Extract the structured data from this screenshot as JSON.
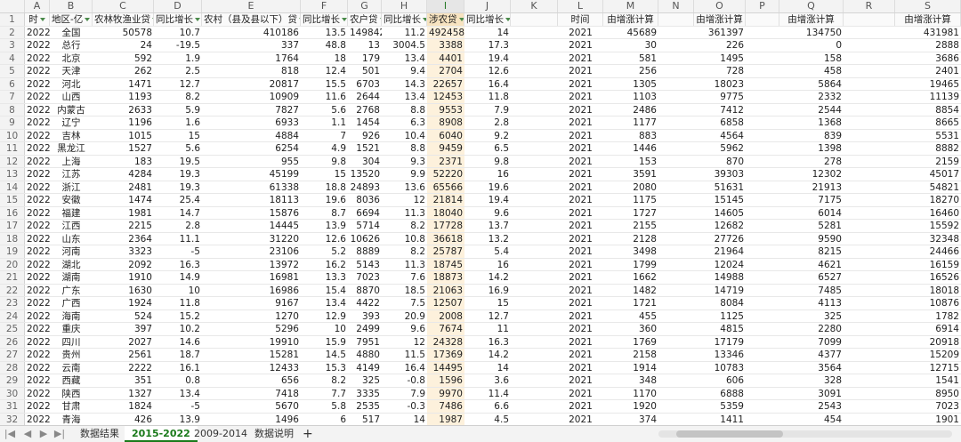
{
  "columns": [
    "A",
    "B",
    "C",
    "D",
    "E",
    "F",
    "G",
    "H",
    "I",
    "J",
    "K",
    "L",
    "M",
    "N",
    "O",
    "P",
    "Q",
    "R",
    "S"
  ],
  "selected_column": "I",
  "header": {
    "A": "时",
    "B": "地区-亿",
    "C": "农林牧渔业贷",
    "D": "同比增长",
    "E": "农村（县及县以下）贷",
    "F": "同比增长",
    "G": "农户贷",
    "H": "同比增长",
    "I": "涉农贷",
    "J": "同比增长",
    "L": "时间",
    "M": "由增涨计算",
    "O": "由增涨计算",
    "Q": "由增涨计算",
    "S": "由增涨计算"
  },
  "rows": [
    [
      "2",
      "2022",
      "全国",
      "50578",
      "10.7",
      "410186",
      "13.5",
      "149842",
      "11.2",
      "492458",
      "14",
      "",
      "2021",
      "45689",
      "",
      "361397",
      "",
      "134750",
      "",
      "431981"
    ],
    [
      "3",
      "2022",
      "总行",
      "24",
      "-19.5",
      "337",
      "48.8",
      "13",
      "3004.5",
      "3388",
      "17.3",
      "",
      "2021",
      "30",
      "",
      "226",
      "",
      "0",
      "",
      "2888"
    ],
    [
      "4",
      "2022",
      "北京",
      "592",
      "1.9",
      "1764",
      "18",
      "179",
      "13.4",
      "4401",
      "19.4",
      "",
      "2021",
      "581",
      "",
      "1495",
      "",
      "158",
      "",
      "3686"
    ],
    [
      "5",
      "2022",
      "天津",
      "262",
      "2.5",
      "818",
      "12.4",
      "501",
      "9.4",
      "2704",
      "12.6",
      "",
      "2021",
      "256",
      "",
      "728",
      "",
      "458",
      "",
      "2401"
    ],
    [
      "6",
      "2022",
      "河北",
      "1471",
      "12.7",
      "20817",
      "15.5",
      "6703",
      "14.3",
      "22657",
      "16.4",
      "",
      "2021",
      "1305",
      "",
      "18023",
      "",
      "5864",
      "",
      "19465"
    ],
    [
      "7",
      "2022",
      "山西",
      "1193",
      "8.2",
      "10909",
      "11.6",
      "2644",
      "13.4",
      "12453",
      "11.8",
      "",
      "2021",
      "1103",
      "",
      "9775",
      "",
      "2332",
      "",
      "11139"
    ],
    [
      "8",
      "2022",
      "内蒙古",
      "2633",
      "5.9",
      "7827",
      "5.6",
      "2768",
      "8.8",
      "9553",
      "7.9",
      "",
      "2021",
      "2486",
      "",
      "7412",
      "",
      "2544",
      "",
      "8854"
    ],
    [
      "9",
      "2022",
      "辽宁",
      "1196",
      "1.6",
      "6933",
      "1.1",
      "1454",
      "6.3",
      "8908",
      "2.8",
      "",
      "2021",
      "1177",
      "",
      "6858",
      "",
      "1368",
      "",
      "8665"
    ],
    [
      "10",
      "2022",
      "吉林",
      "1015",
      "15",
      "4884",
      "7",
      "926",
      "10.4",
      "6040",
      "9.2",
      "",
      "2021",
      "883",
      "",
      "4564",
      "",
      "839",
      "",
      "5531"
    ],
    [
      "11",
      "2022",
      "黑龙江",
      "1527",
      "5.6",
      "6254",
      "4.9",
      "1521",
      "8.8",
      "9459",
      "6.5",
      "",
      "2021",
      "1446",
      "",
      "5962",
      "",
      "1398",
      "",
      "8882"
    ],
    [
      "12",
      "2022",
      "上海",
      "183",
      "19.5",
      "955",
      "9.8",
      "304",
      "9.3",
      "2371",
      "9.8",
      "",
      "2021",
      "153",
      "",
      "870",
      "",
      "278",
      "",
      "2159"
    ],
    [
      "13",
      "2022",
      "江苏",
      "4284",
      "19.3",
      "45199",
      "15",
      "13520",
      "9.9",
      "52220",
      "16",
      "",
      "2021",
      "3591",
      "",
      "39303",
      "",
      "12302",
      "",
      "45017"
    ],
    [
      "14",
      "2022",
      "浙江",
      "2481",
      "19.3",
      "61338",
      "18.8",
      "24893",
      "13.6",
      "65566",
      "19.6",
      "",
      "2021",
      "2080",
      "",
      "51631",
      "",
      "21913",
      "",
      "54821"
    ],
    [
      "15",
      "2022",
      "安徽",
      "1474",
      "25.4",
      "18113",
      "19.6",
      "8036",
      "12",
      "21814",
      "19.4",
      "",
      "2021",
      "1175",
      "",
      "15145",
      "",
      "7175",
      "",
      "18270"
    ],
    [
      "16",
      "2022",
      "福建",
      "1981",
      "14.7",
      "15876",
      "8.7",
      "6694",
      "11.3",
      "18040",
      "9.6",
      "",
      "2021",
      "1727",
      "",
      "14605",
      "",
      "6014",
      "",
      "16460"
    ],
    [
      "17",
      "2022",
      "江西",
      "2215",
      "2.8",
      "14445",
      "13.9",
      "5714",
      "8.2",
      "17728",
      "13.7",
      "",
      "2021",
      "2155",
      "",
      "12682",
      "",
      "5281",
      "",
      "15592"
    ],
    [
      "18",
      "2022",
      "山东",
      "2364",
      "11.1",
      "31220",
      "12.6",
      "10626",
      "10.8",
      "36618",
      "13.2",
      "",
      "2021",
      "2128",
      "",
      "27726",
      "",
      "9590",
      "",
      "32348"
    ],
    [
      "19",
      "2022",
      "河南",
      "3323",
      "-5",
      "23106",
      "5.2",
      "8889",
      "8.2",
      "25787",
      "5.4",
      "",
      "2021",
      "3498",
      "",
      "21964",
      "",
      "8215",
      "",
      "24466"
    ],
    [
      "20",
      "2022",
      "湖北",
      "2092",
      "16.3",
      "13972",
      "16.2",
      "5143",
      "11.3",
      "18745",
      "16",
      "",
      "2021",
      "1799",
      "",
      "12024",
      "",
      "4621",
      "",
      "16159"
    ],
    [
      "21",
      "2022",
      "湖南",
      "1910",
      "14.9",
      "16981",
      "13.3",
      "7023",
      "7.6",
      "18873",
      "14.2",
      "",
      "2021",
      "1662",
      "",
      "14988",
      "",
      "6527",
      "",
      "16526"
    ],
    [
      "22",
      "2022",
      "广东",
      "1630",
      "10",
      "16986",
      "15.4",
      "8870",
      "18.5",
      "21063",
      "16.9",
      "",
      "2021",
      "1482",
      "",
      "14719",
      "",
      "7485",
      "",
      "18018"
    ],
    [
      "23",
      "2022",
      "广西",
      "1924",
      "11.8",
      "9167",
      "13.4",
      "4422",
      "7.5",
      "12507",
      "15",
      "",
      "2021",
      "1721",
      "",
      "8084",
      "",
      "4113",
      "",
      "10876"
    ],
    [
      "24",
      "2022",
      "海南",
      "524",
      "15.2",
      "1270",
      "12.9",
      "393",
      "20.9",
      "2008",
      "12.7",
      "",
      "2021",
      "455",
      "",
      "1125",
      "",
      "325",
      "",
      "1782"
    ],
    [
      "25",
      "2022",
      "重庆",
      "397",
      "10.2",
      "5296",
      "10",
      "2499",
      "9.6",
      "7674",
      "11",
      "",
      "2021",
      "360",
      "",
      "4815",
      "",
      "2280",
      "",
      "6914"
    ],
    [
      "26",
      "2022",
      "四川",
      "2027",
      "14.6",
      "19910",
      "15.9",
      "7951",
      "12",
      "24328",
      "16.3",
      "",
      "2021",
      "1769",
      "",
      "17179",
      "",
      "7099",
      "",
      "20918"
    ],
    [
      "27",
      "2022",
      "贵州",
      "2561",
      "18.7",
      "15281",
      "14.5",
      "4880",
      "11.5",
      "17369",
      "14.2",
      "",
      "2021",
      "2158",
      "",
      "13346",
      "",
      "4377",
      "",
      "15209"
    ],
    [
      "28",
      "2022",
      "云南",
      "2222",
      "16.1",
      "12433",
      "15.3",
      "4149",
      "16.4",
      "14495",
      "14",
      "",
      "2021",
      "1914",
      "",
      "10783",
      "",
      "3564",
      "",
      "12715"
    ],
    [
      "29",
      "2022",
      "西藏",
      "351",
      "0.8",
      "656",
      "8.2",
      "325",
      "-0.8",
      "1596",
      "3.6",
      "",
      "2021",
      "348",
      "",
      "606",
      "",
      "328",
      "",
      "1541"
    ],
    [
      "30",
      "2022",
      "陕西",
      "1327",
      "13.4",
      "7418",
      "7.7",
      "3335",
      "7.9",
      "9970",
      "11.4",
      "",
      "2021",
      "1170",
      "",
      "6888",
      "",
      "3091",
      "",
      "8950"
    ],
    [
      "31",
      "2022",
      "甘肃",
      "1824",
      "-5",
      "5670",
      "5.8",
      "2535",
      "-0.3",
      "7486",
      "6.6",
      "",
      "2021",
      "1920",
      "",
      "5359",
      "",
      "2543",
      "",
      "7023"
    ],
    [
      "32",
      "2022",
      "青海",
      "426",
      "13.9",
      "1496",
      "6",
      "517",
      "14",
      "1987",
      "4.5",
      "",
      "2021",
      "374",
      "",
      "1411",
      "",
      "454",
      "",
      "1901"
    ]
  ],
  "tabs": [
    "数据结果",
    "2015-2022",
    "2009-2014",
    "数据说明"
  ],
  "active_tab": "2015-2022",
  "add_tab_label": "+",
  "nav": {
    "first": "|◀",
    "prev": "◀",
    "next": "▶",
    "last": "▶|"
  }
}
